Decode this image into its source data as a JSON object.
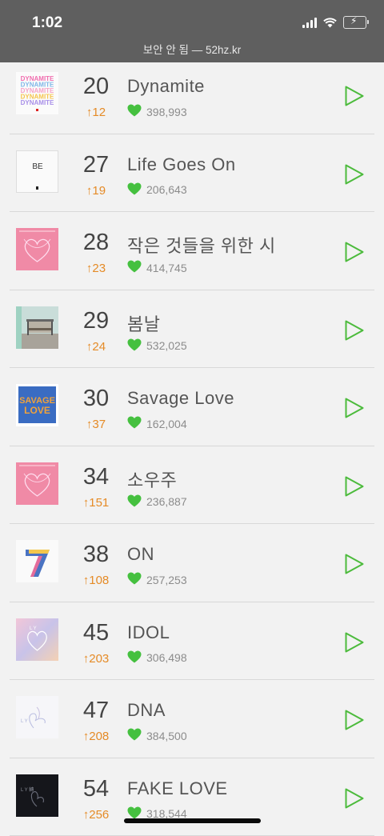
{
  "status": {
    "time": "1:02",
    "url": "보안 안 됨 — 52hz.kr"
  },
  "colors": {
    "rank_change": "#e58b27",
    "heart": "#45c03f",
    "play": "#4cbb3c"
  },
  "songs": [
    {
      "rank": "20",
      "change": "↑12",
      "title": "Dynamite",
      "likes": "398,993",
      "cover": "dynamite"
    },
    {
      "rank": "27",
      "change": "↑19",
      "title": "Life Goes On",
      "likes": "206,643",
      "cover": "be"
    },
    {
      "rank": "28",
      "change": "↑23",
      "title": "작은 것들을 위한 시",
      "likes": "414,745",
      "cover": "persona"
    },
    {
      "rank": "29",
      "change": "↑24",
      "title": "봄날",
      "likes": "532,025",
      "cover": "spring-day"
    },
    {
      "rank": "30",
      "change": "↑37",
      "title": "Savage Love",
      "likes": "162,004",
      "cover": "savage-love"
    },
    {
      "rank": "34",
      "change": "↑151",
      "title": "소우주",
      "likes": "236,887",
      "cover": "persona"
    },
    {
      "rank": "38",
      "change": "↑108",
      "title": "ON",
      "likes": "257,253",
      "cover": "map-of-the-soul-7"
    },
    {
      "rank": "45",
      "change": "↑203",
      "title": "IDOL",
      "likes": "306,498",
      "cover": "answer"
    },
    {
      "rank": "47",
      "change": "↑208",
      "title": "DNA",
      "likes": "384,500",
      "cover": "her"
    },
    {
      "rank": "54",
      "change": "↑256",
      "title": "FAKE LOVE",
      "likes": "318,544",
      "cover": "tear"
    }
  ]
}
